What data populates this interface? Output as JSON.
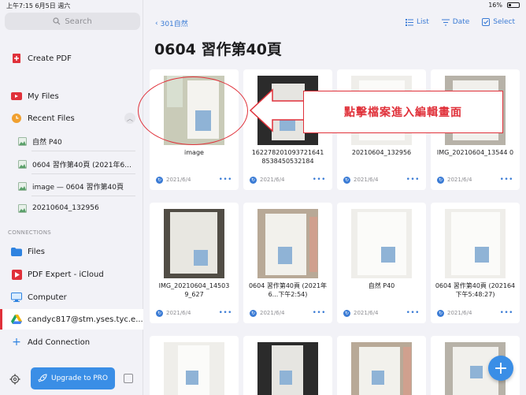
{
  "status_bar": {
    "time": "上午7:15",
    "date": "6月5日 週六",
    "battery": "16%"
  },
  "sidebar": {
    "search_placeholder": "Search",
    "create_pdf": "Create PDF",
    "my_files": "My Files",
    "recent_files": "Recent Files",
    "recent_items": [
      "自然 P40",
      "0604 習作第40頁 (2021年6...",
      "image — 0604 習作第40頁",
      "20210604_132956"
    ],
    "connections_label": "CONNECTIONS",
    "connections": [
      "Files",
      "PDF Expert - iCloud",
      "Computer",
      "candyc817@stm.yses.tyc.e...",
      "Add Connection"
    ],
    "upgrade_label": "Upgrade to PRO"
  },
  "main": {
    "back_label": "301自然",
    "toolbar": {
      "list": "List",
      "date": "Date",
      "select": "Select"
    },
    "title": "0604 習作第40頁",
    "callout_text": "點擊檔案進入編輯畫面",
    "files": [
      {
        "name": "image",
        "date": "2021/6/4"
      },
      {
        "name": "162278201093721641 8538450532184",
        "date": "2021/6/4"
      },
      {
        "name": "20210604_132956",
        "date": "2021/6/4"
      },
      {
        "name": "IMG_20210604_13544 0",
        "date": "2021/6/4"
      },
      {
        "name": "IMG_20210604_14503 9_627",
        "date": "2021/6/4"
      },
      {
        "name": "0604 習作第40頁 (2021年6...下午2:54)",
        "date": "2021/6/4"
      },
      {
        "name": "自然 P40",
        "date": "2021/6/4"
      },
      {
        "name": "0604 習作第40頁 (202164 下午5:48:27)",
        "date": "2021/6/4"
      }
    ]
  },
  "colors": {
    "accent": "#3a8ee6",
    "annotation": "#e0313a"
  }
}
